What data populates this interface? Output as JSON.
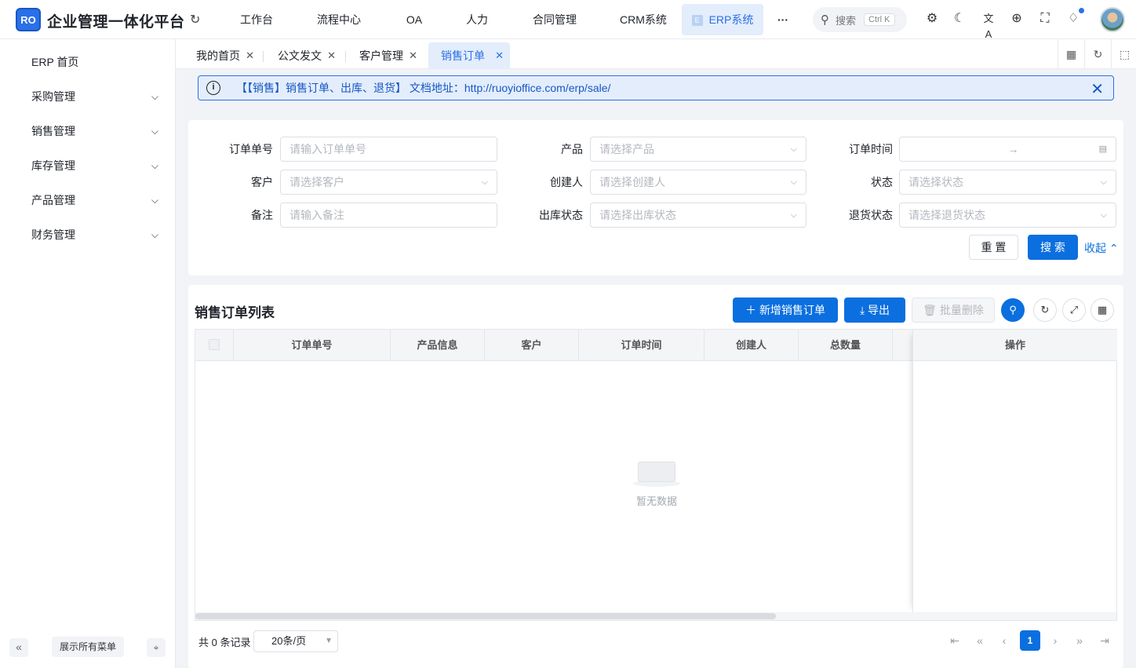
{
  "app": {
    "logo_text": "RO",
    "title": "企业管理一体化平台"
  },
  "topnav": [
    {
      "label": "工作台"
    },
    {
      "label": "流程中心"
    },
    {
      "label": "OA"
    },
    {
      "label": "人力"
    },
    {
      "label": "合同管理"
    },
    {
      "label": "CRM系统"
    },
    {
      "label": "ERP系统",
      "badge": "E",
      "active": true
    },
    {
      "label": "···"
    }
  ],
  "search": {
    "placeholder": "搜索",
    "shortcut": "Ctrl K"
  },
  "sidebar": {
    "items": [
      {
        "label": "ERP 首页",
        "expandable": false
      },
      {
        "label": "采购管理",
        "expandable": true
      },
      {
        "label": "销售管理",
        "expandable": true
      },
      {
        "label": "库存管理",
        "expandable": true
      },
      {
        "label": "产品管理",
        "expandable": true
      },
      {
        "label": "财务管理",
        "expandable": true
      }
    ],
    "show_all_label": "展示所有菜单"
  },
  "tabs": [
    {
      "label": "我的首页"
    },
    {
      "label": "公文发文"
    },
    {
      "label": "客户管理"
    },
    {
      "label": "销售订单",
      "active": true
    }
  ],
  "alert": {
    "text": "【【销售】销售订单、出库、退货】 文档地址：http://ruoyioffice.com/erp/sale/"
  },
  "filters": {
    "order_no": {
      "label": "订单单号",
      "placeholder": "请输入订单单号"
    },
    "product": {
      "label": "产品",
      "placeholder": "请选择产品"
    },
    "order_time": {
      "label": "订单时间",
      "placeholder": "→"
    },
    "customer": {
      "label": "客户",
      "placeholder": "请选择客户"
    },
    "creator": {
      "label": "创建人",
      "placeholder": "请选择创建人"
    },
    "status": {
      "label": "状态",
      "placeholder": "请选择状态"
    },
    "remark": {
      "label": "备注",
      "placeholder": "请输入备注"
    },
    "outbound_status": {
      "label": "出库状态",
      "placeholder": "请选择出库状态"
    },
    "return_status": {
      "label": "退货状态",
      "placeholder": "请选择退货状态"
    },
    "reset_label": "重 置",
    "search_label": "搜 索",
    "collapse_label": "收起"
  },
  "list": {
    "title": "销售订单列表",
    "add_label": "新增销售订单",
    "export_label": "导出",
    "batch_delete_label": "批量删除",
    "columns": [
      "订单单号",
      "产品信息",
      "客户",
      "订单时间",
      "创建人",
      "总数量"
    ],
    "action_column": "操作",
    "empty_text": "暂无数据"
  },
  "pagination": {
    "total_text": "共 0 条记录",
    "page_size": "20条/页",
    "current_page": "1"
  },
  "colors": {
    "primary": "#0b6fdf",
    "active_bg": "#e3edfb",
    "page_bg": "#f1f3f6"
  }
}
